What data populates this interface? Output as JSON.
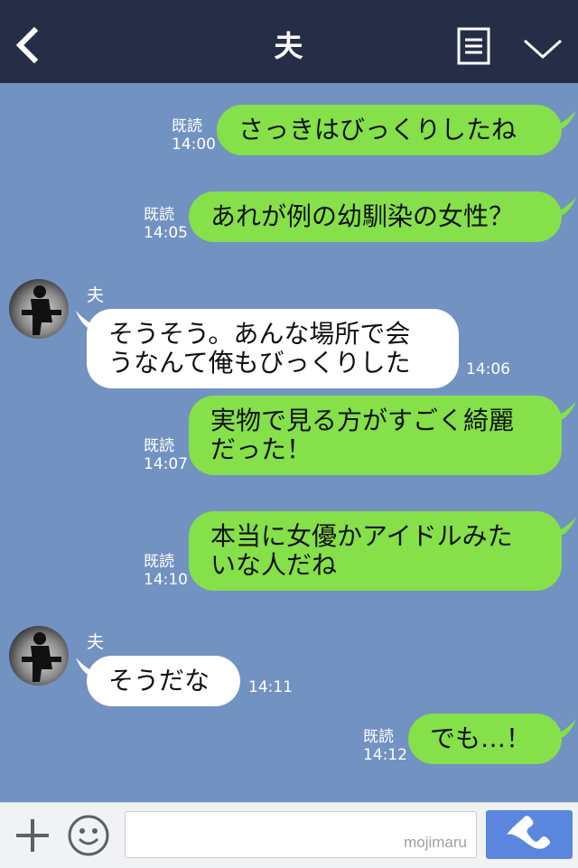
{
  "header": {
    "title": "夫"
  },
  "messages": [
    {
      "side": "me",
      "text": "さっきはびっくりしたね",
      "read": "既読",
      "time": "14:00"
    },
    {
      "side": "me",
      "text": "あれが例の幼馴染の女性？",
      "read": "既読",
      "time": "14:05"
    },
    {
      "side": "them",
      "sender": "夫",
      "text": "そうそう。あんな場所で会\nうなんて俺もびっくりした",
      "time": "14:06"
    },
    {
      "side": "me",
      "text": "実物で見る方がすごく綺麗\nだった！",
      "read": "既読",
      "time": "14:07"
    },
    {
      "side": "me",
      "text": "本当に女優かアイドルみた\nいな人だね",
      "read": "既読",
      "time": "14:10"
    },
    {
      "side": "them",
      "sender": "夫",
      "text": "そうだな",
      "time": "14:11"
    },
    {
      "side": "me",
      "text": "でも…！",
      "read": "既読",
      "time": "14:12"
    }
  ],
  "input": {
    "watermark": "mojimaru"
  },
  "icons": {
    "back": "chevron-left-icon",
    "menu": "notes-icon",
    "collapse": "chevron-down-icon",
    "plus": "plus-icon",
    "emoji": "smiley-icon",
    "call": "phone-icon"
  },
  "colors": {
    "header_bg": "#262e47",
    "chat_bg": "#7292c2",
    "my_bubble": "#85e04a",
    "their_bubble": "#ffffff",
    "call_button": "#5a86de"
  }
}
